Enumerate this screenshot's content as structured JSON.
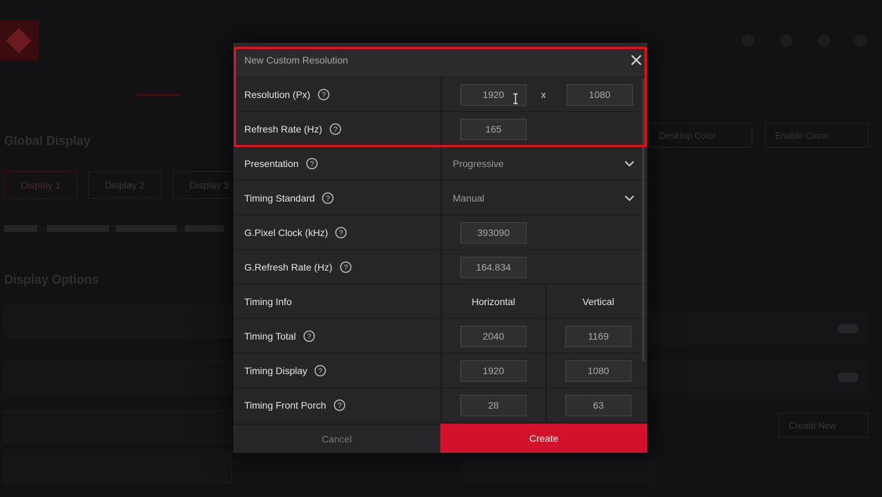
{
  "background": {
    "section_global_display": "Global Display",
    "section_display_options": "Display Options",
    "display_tabs": [
      "Display 1",
      "Display 2",
      "Display 3"
    ],
    "desktop_color_label": "Desktop Color",
    "enable_clone_label": "Enable Clone",
    "create_new_label": "Create New"
  },
  "dialog": {
    "title": "New Custom Resolution",
    "close_icon": "close-icon",
    "resolution": {
      "label": "Resolution (Px)",
      "horizontal": "1920",
      "separator": "x",
      "vertical": "1080"
    },
    "refresh_rate": {
      "label": "Refresh Rate (Hz)",
      "value": "165"
    },
    "presentation": {
      "label": "Presentation",
      "value": "Progressive"
    },
    "timing_standard": {
      "label": "Timing Standard",
      "value": "Manual"
    },
    "g_pixel_clock": {
      "label": "G.Pixel Clock (kHz)",
      "value": "393090"
    },
    "g_refresh_rate": {
      "label": "G.Refresh Rate (Hz)",
      "value": "164.834"
    },
    "timing_info": {
      "label": "Timing Info",
      "horizontal_header": "Horizontal",
      "vertical_header": "Vertical"
    },
    "timing_total": {
      "label": "Timing Total",
      "horizontal": "2040",
      "vertical": "1169"
    },
    "timing_display": {
      "label": "Timing Display",
      "horizontal": "1920",
      "vertical": "1080"
    },
    "timing_front_porch": {
      "label": "Timing Front Porch",
      "horizontal": "28",
      "vertical": "63"
    },
    "cancel_label": "Cancel",
    "create_label": "Create"
  },
  "colors": {
    "accent": "#d2112a",
    "highlight_border": "#e2131f",
    "dialog_bg": "#262628"
  }
}
